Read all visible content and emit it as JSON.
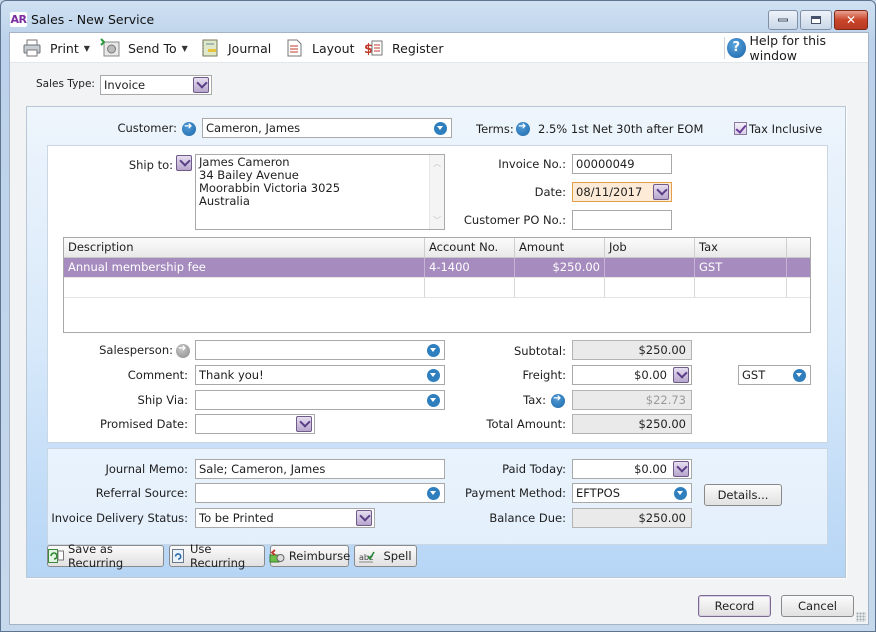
{
  "window": {
    "app_badge": "AR",
    "title": "Sales - New Service",
    "controls": {
      "minimize": "minimize",
      "maximize": "maximize",
      "close": "✕"
    }
  },
  "toolbar": {
    "print": "Print",
    "send_to": "Send To",
    "journal": "Journal",
    "layout": "Layout",
    "register": "Register",
    "help": "Help for this window",
    "help_glyph": "?"
  },
  "sales_type": {
    "label": "Sales Type:",
    "value": "Invoice"
  },
  "header": {
    "customer_label": "Customer:",
    "customer_value": "Cameron, James",
    "terms_label": "Terms:",
    "terms_value": "2.5% 1st Net 30th after EOM",
    "tax_inclusive_label": "Tax Inclusive",
    "tax_inclusive_checked": true
  },
  "ship_to": {
    "label": "Ship to:",
    "lines": [
      "James Cameron",
      "34 Bailey Avenue",
      "Moorabbin  Victoria  3025",
      "Australia"
    ]
  },
  "invoice": {
    "invoice_no_label": "Invoice No.:",
    "invoice_no": "00000049",
    "date_label": "Date:",
    "date": "08/11/2017",
    "po_label": "Customer PO No.:",
    "po": ""
  },
  "grid": {
    "columns": [
      "Description",
      "Account No.",
      "Amount",
      "Job",
      "Tax"
    ],
    "rows": [
      {
        "description": "Annual membership fee",
        "account": "4-1400",
        "amount": "$250.00",
        "job": "",
        "tax": "GST",
        "selected": true
      },
      {
        "description": "",
        "account": "",
        "amount": "",
        "job": "",
        "tax": "",
        "selected": false
      }
    ]
  },
  "details": {
    "salesperson_label": "Salesperson:",
    "salesperson": "",
    "comment_label": "Comment:",
    "comment": "Thank you!",
    "ship_via_label": "Ship Via:",
    "ship_via": "",
    "promised_date_label": "Promised Date:",
    "promised_date": ""
  },
  "totals": {
    "subtotal_label": "Subtotal:",
    "subtotal": "$250.00",
    "freight_label": "Freight:",
    "freight": "$0.00",
    "freight_tax": "GST",
    "tax_label": "Tax:",
    "tax": "$22.73",
    "total_label": "Total Amount:",
    "total": "$250.00"
  },
  "payment": {
    "journal_memo_label": "Journal Memo:",
    "journal_memo": "Sale; Cameron, James",
    "referral_label": "Referral Source:",
    "referral": "",
    "delivery_label": "Invoice Delivery Status:",
    "delivery": "To be Printed",
    "paid_today_label": "Paid Today:",
    "paid_today": "$0.00",
    "method_label": "Payment Method:",
    "method": "EFTPOS",
    "details_button": "Details...",
    "balance_label": "Balance Due:",
    "balance": "$250.00"
  },
  "actions": {
    "save_recurring": "Save as Recurring",
    "use_recurring": "Use Recurring",
    "reimburse": "Reimburse",
    "spell": "Spell",
    "record": "Record",
    "cancel": "Cancel"
  },
  "colors": {
    "selected_row": "#a68bbf",
    "accent_blue": "#2f7fbf",
    "date_field_bg": "#fdebd8"
  }
}
